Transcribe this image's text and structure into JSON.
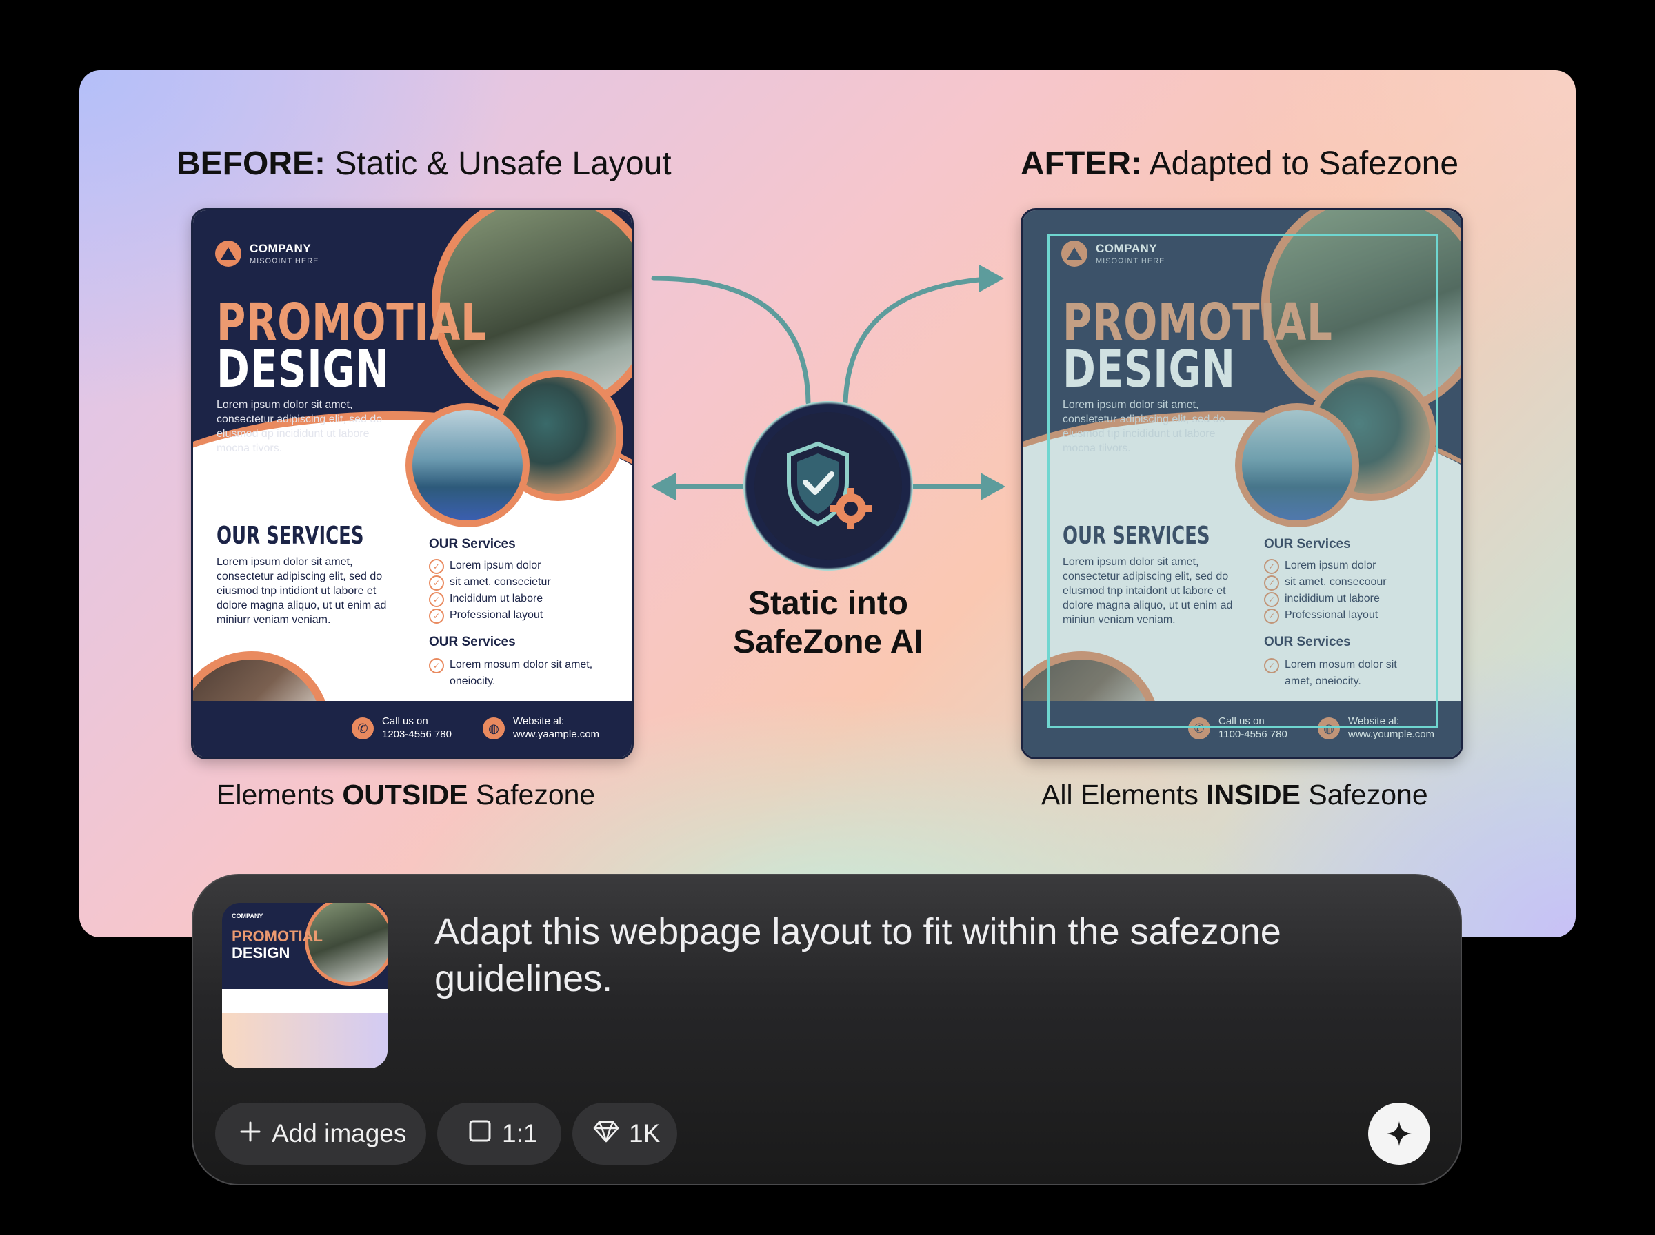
{
  "before": {
    "heading_bold": "BEFORE:",
    "heading_rest": "Static & Unsafe Layout",
    "caption_pre": "Elements",
    "caption_bold": "OUTSIDE",
    "caption_post": "Safezone",
    "flyer": {
      "company": "COMPANY",
      "tagline": "MISOΩINT HERE",
      "promo_line1": "PROMOTIAL",
      "promo_line2": "DESIGN",
      "intro": "Lorem ipsum dolor sit amet, consectetur adipiscing elit, sed do elusmod ɑp incididunt ut labore mocna tivors.",
      "services_heading": "OUR SERVICES",
      "services_text": "Lorem ipsum dolor sit amet, consectetur adipiscing elit, sed do eiusmod tnp intidiont ut labore et dolore magna aliquo, ut ut enim ad miniurr veniam veniam.",
      "col_heading_1": "OUR Services",
      "col_items_1": [
        "Lorem ipsum dolor",
        "sit amet, consecietur",
        "Incididum ut labore",
        "Professional layout"
      ],
      "col_heading_2": "OUR Services",
      "col_items_2": [
        "Lorem mosum dolor sit amet, oneiocity."
      ],
      "call_label": "Call us on",
      "call_value": "1203-4556 780",
      "web_label": "Website al:",
      "web_value": "www.yaample.com"
    }
  },
  "after": {
    "heading_bold": "AFTER:",
    "heading_rest": "Adapted to Safezone",
    "caption_pre": "All Elements",
    "caption_bold": "INSIDE",
    "caption_post": "Safezone",
    "flyer": {
      "company": "COMPANY",
      "tagline": "MISOΩINT HERE",
      "promo_line1": "PROMOTIAL",
      "promo_line2": "DESIGN",
      "intro": "Lorem ipsum dolor sit amet, consletetur adipiscing elit, sed do elusmod tıp incididunt ut labore mocna tiivors.",
      "services_heading": "OUR SERVICES",
      "services_text": "Lorem ipsum dolor sit amet, consectetur adipiscing elit, sed do elusmod tnp intaidont ut labore et dolore magna aliquo, ut ut enim ad miniun veniam veniam.",
      "col_heading_1": "OUR Services",
      "col_items_1": [
        "Lorem ipsum dolor",
        "sit amet, consecoour",
        "incididium ut labore",
        "Professional layout"
      ],
      "col_heading_2": "OUR Services",
      "col_items_2": [
        "Lorem mosum dolor sit amet, oneiocity."
      ],
      "call_label": "Call us on",
      "call_value": "1100-4556 780",
      "web_label": "Website al:",
      "web_value": "www.youmple.com"
    }
  },
  "center": {
    "title": "Static into SafeZone AI",
    "icon": "shield-gear-icon"
  },
  "prompt": {
    "text": "Adapt this webpage layout to fit within the safezone guidelines.",
    "thumbnail": {
      "company": "COMPANY",
      "promo_line1": "PROMOTIAL",
      "promo_line2": "DESIGN"
    },
    "chips": {
      "add_images": "Add images",
      "aspect": "1:1",
      "credits": "1K"
    },
    "send_icon": "sparkle-icon"
  },
  "colors": {
    "navy": "#1c2447",
    "orange": "#e98a5f",
    "teal": "#5d9c9c",
    "safezone": "#6fd6d0"
  }
}
